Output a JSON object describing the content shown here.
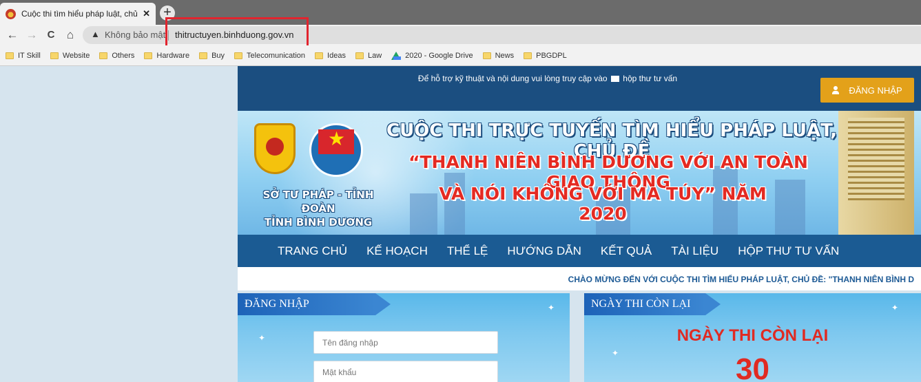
{
  "browser": {
    "tab_title": "Cuộc thi tìm hiểu pháp luật, chủ đ",
    "tab_close": "✕",
    "new_tab": "+",
    "back": "←",
    "forward": "→",
    "reload": "C",
    "home": "⌂",
    "security_warning": "▲",
    "security_label": "Không bảo mật",
    "url": "thitructuyen.binhduong.gov.vn",
    "bookmarks": [
      "IT Skill",
      "Website",
      "Others",
      "Hardware",
      "Buy",
      "Telecomunication",
      "Ideas",
      "Law",
      "2020 - Google Drive",
      "News",
      "PBGDPL"
    ]
  },
  "header": {
    "support_text_pre": "Để hỗ trợ kỹ thuật và nội dung vui lòng truy cập vào",
    "support_link": "hộp thư tư vấn",
    "login_button": "ĐĂNG NHẬP"
  },
  "banner": {
    "agency_line1": "SỞ TƯ PHÁP - TỈNH ĐOÀN",
    "agency_line2": "TỈNH BÌNH DƯƠNG",
    "headline_1": "CUỘC THI TRỰC TUYẾN TÌM HIỂU PHÁP LUẬT, CHỦ ĐỀ",
    "headline_2": "“THANH NIÊN BÌNH DƯƠNG VỚI AN TOÀN GIAO THÔNG",
    "headline_3": "VÀ NÓI KHÔNG VỚI MA TÚY” NĂM 2020"
  },
  "nav": {
    "items": [
      "TRANG CHỦ",
      "KẾ HOẠCH",
      "THỂ LỆ",
      "HƯỚNG DẪN",
      "KẾT QUẢ",
      "TÀI LIỆU",
      "HỘP THƯ TƯ VẤN"
    ]
  },
  "marquee": {
    "text": "CHÀO MỪNG ĐẾN VỚI CUỘC THI TÌM HIỂU PHÁP LUẬT, CHỦ ĐỀ: \"THANH NIÊN BÌNH D"
  },
  "login_panel": {
    "title": "ĐĂNG NHẬP",
    "username_placeholder": "Tên đăng nhập",
    "password_placeholder": "Mật khẩu"
  },
  "countdown_panel": {
    "title": "NGÀY THI CÒN LẠI",
    "heading": "NGÀY THI CÒN LẠI",
    "days": "30"
  },
  "colors": {
    "header_blue": "#1b4e80",
    "nav_blue": "#1b5b93",
    "login_orange": "#e3a11a",
    "highlight_red": "#e2242e",
    "countdown_red": "#e02a22"
  }
}
